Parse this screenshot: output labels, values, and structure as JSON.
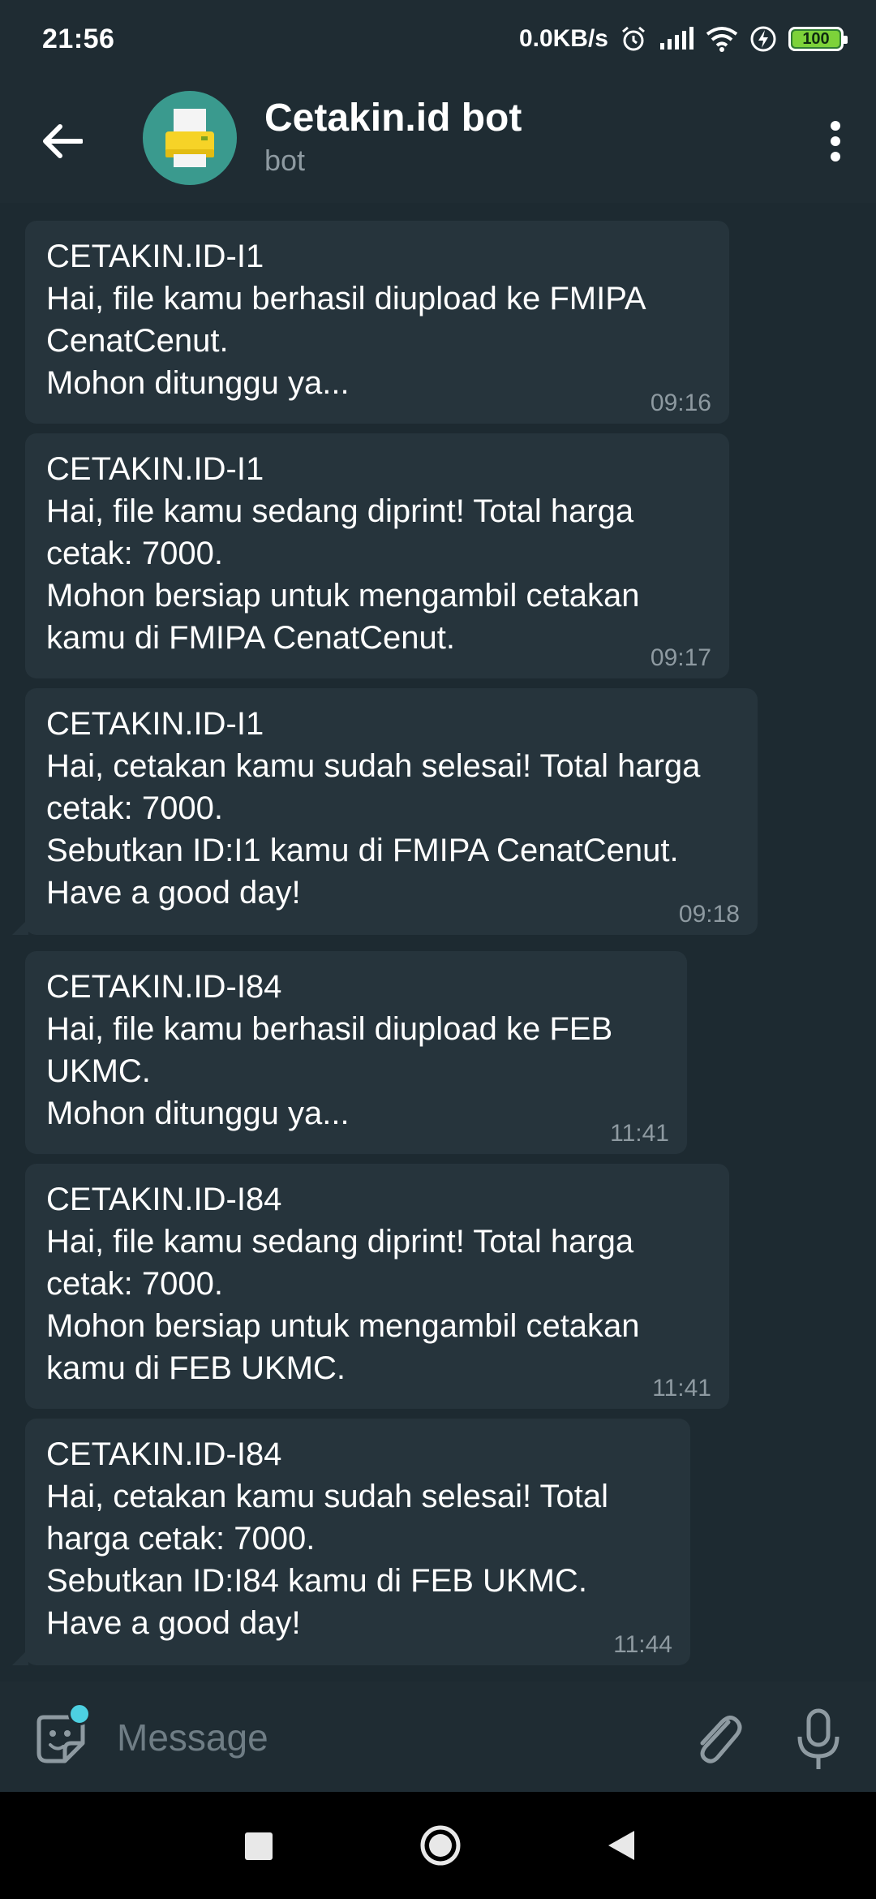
{
  "status_bar": {
    "time": "21:56",
    "net_speed": "0.0KB/s",
    "battery": "100",
    "icons": [
      "alarm-icon",
      "signal-icon",
      "wifi-icon",
      "charging-icon",
      "battery-icon"
    ]
  },
  "header": {
    "title": "Cetakin.id bot",
    "subtitle": "bot",
    "avatar_icon": "printer-icon"
  },
  "messages": [
    {
      "text": "CETAKIN.ID-I1\nHai, file kamu berhasil diupload ke FMIPA CenatCenut.\nMohon ditunggu ya...",
      "time": "09:16"
    },
    {
      "text": "CETAKIN.ID-I1\nHai, file kamu sedang diprint! Total harga cetak: 7000.\nMohon bersiap untuk mengambil cetakan kamu di FMIPA CenatCenut.",
      "time": "09:17"
    },
    {
      "text": "CETAKIN.ID-I1\nHai, cetakan kamu sudah selesai! Total harga cetak: 7000.\nSebutkan ID:I1 kamu di FMIPA CenatCenut.\nHave a good day!",
      "time": "09:18"
    },
    {
      "text": "CETAKIN.ID-I84\nHai, file kamu berhasil diupload ke FEB UKMC.\nMohon ditunggu ya...",
      "time": "11:41"
    },
    {
      "text": "CETAKIN.ID-I84\nHai, file kamu sedang diprint! Total harga cetak: 7000.\nMohon bersiap untuk mengambil cetakan kamu di FEB UKMC.",
      "time": "11:41"
    },
    {
      "text": "CETAKIN.ID-I84\nHai, cetakan kamu sudah selesai! Total harga cetak: 7000.\nSebutkan ID:I84 kamu di FEB UKMC.\nHave a good day!",
      "time": "11:44"
    }
  ],
  "input": {
    "placeholder": "Message"
  },
  "colors": {
    "background": "#1d2a31",
    "bar": "#1f2c33",
    "bubble": "#26343c",
    "secondary_text": "#8e9aa1",
    "accent": "#4dd0e1"
  }
}
